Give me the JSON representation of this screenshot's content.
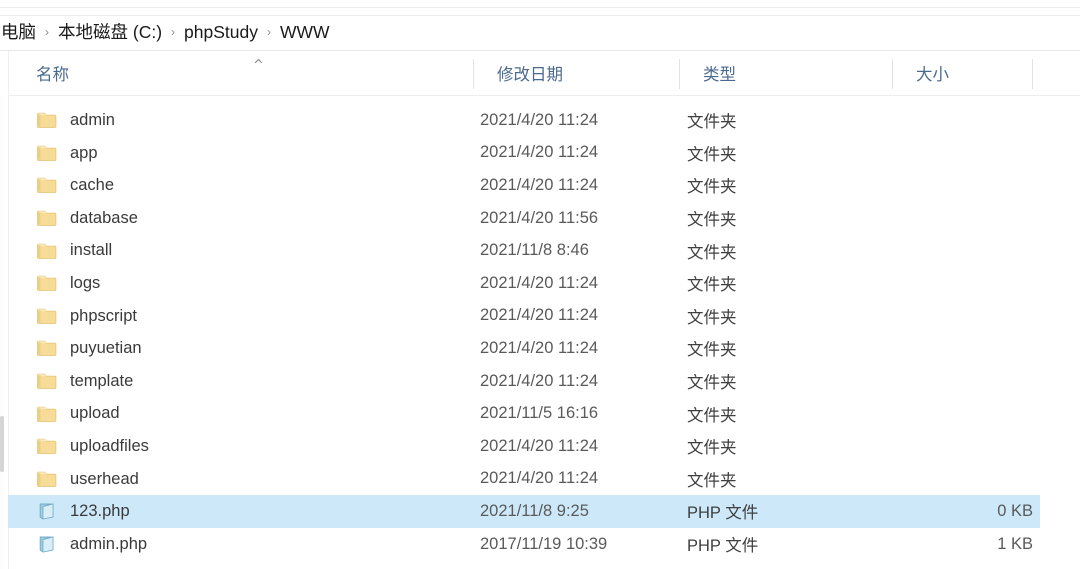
{
  "window": {
    "app": "Windows File Explorer"
  },
  "breadcrumb": {
    "separator": "›",
    "items": [
      {
        "label": "电脑"
      },
      {
        "label": "本地磁盘 (C:)"
      },
      {
        "label": "phpStudy"
      },
      {
        "label": "WWW"
      }
    ]
  },
  "columns": {
    "sort_indicator": "^",
    "headers": [
      {
        "key": "name",
        "label": "名称"
      },
      {
        "key": "date",
        "label": "修改日期"
      },
      {
        "key": "type",
        "label": "类型"
      },
      {
        "key": "size",
        "label": "大小"
      }
    ]
  },
  "types": {
    "folder": "文件夹",
    "php": "PHP 文件"
  },
  "colors": {
    "selection": "#cce8f9",
    "header_text": "#4b6a8f",
    "folder_icon": "#f5d27a",
    "php_icon": "#a8d8ec"
  },
  "files": [
    {
      "name": "admin",
      "date": "2021/4/20 11:24",
      "type": "文件夹",
      "size": "",
      "icon": "folder-icon",
      "selected": false
    },
    {
      "name": "app",
      "date": "2021/4/20 11:24",
      "type": "文件夹",
      "size": "",
      "icon": "folder-icon",
      "selected": false
    },
    {
      "name": "cache",
      "date": "2021/4/20 11:24",
      "type": "文件夹",
      "size": "",
      "icon": "folder-icon",
      "selected": false
    },
    {
      "name": "database",
      "date": "2021/4/20 11:56",
      "type": "文件夹",
      "size": "",
      "icon": "folder-icon",
      "selected": false
    },
    {
      "name": "install",
      "date": "2021/11/8 8:46",
      "type": "文件夹",
      "size": "",
      "icon": "folder-icon",
      "selected": false
    },
    {
      "name": "logs",
      "date": "2021/4/20 11:24",
      "type": "文件夹",
      "size": "",
      "icon": "folder-icon",
      "selected": false
    },
    {
      "name": "phpscript",
      "date": "2021/4/20 11:24",
      "type": "文件夹",
      "size": "",
      "icon": "folder-icon",
      "selected": false
    },
    {
      "name": "puyuetian",
      "date": "2021/4/20 11:24",
      "type": "文件夹",
      "size": "",
      "icon": "folder-icon",
      "selected": false
    },
    {
      "name": "template",
      "date": "2021/4/20 11:24",
      "type": "文件夹",
      "size": "",
      "icon": "folder-icon",
      "selected": false
    },
    {
      "name": "upload",
      "date": "2021/11/5 16:16",
      "type": "文件夹",
      "size": "",
      "icon": "folder-icon",
      "selected": false
    },
    {
      "name": "uploadfiles",
      "date": "2021/4/20 11:24",
      "type": "文件夹",
      "size": "",
      "icon": "folder-icon",
      "selected": false
    },
    {
      "name": "userhead",
      "date": "2021/4/20 11:24",
      "type": "文件夹",
      "size": "",
      "icon": "folder-icon",
      "selected": false
    },
    {
      "name": "123.php",
      "date": "2021/11/8 9:25",
      "type": "PHP 文件",
      "size": "0 KB",
      "icon": "php-file-icon",
      "selected": true
    },
    {
      "name": "admin.php",
      "date": "2017/11/19 10:39",
      "type": "PHP 文件",
      "size": "1 KB",
      "icon": "php-file-icon",
      "selected": false
    }
  ]
}
